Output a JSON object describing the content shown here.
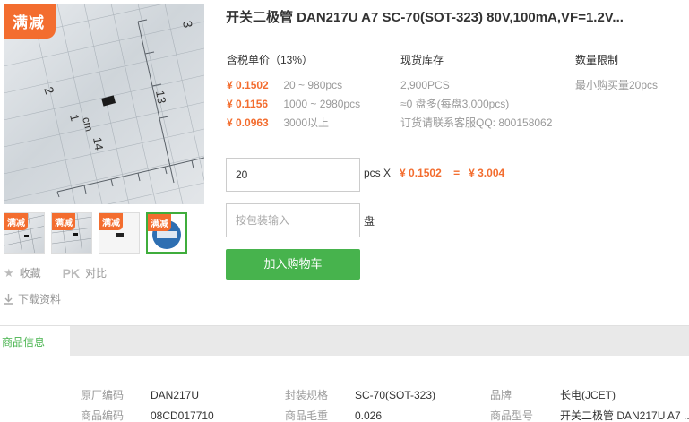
{
  "gallery": {
    "promo_tag": "满减",
    "thumb_tags": [
      "满减",
      "满减",
      "满减",
      "满减"
    ],
    "ruler_numbers": [
      "2",
      "3",
      "1",
      "cm",
      "14",
      "13"
    ]
  },
  "actions": {
    "favorite": "收藏",
    "pk": "PK",
    "compare": "对比",
    "download": "下载资料"
  },
  "product": {
    "title": "开关二极管 DAN217U A7  SC-70(SOT-323) 80V,100mA,VF=1.2V..."
  },
  "pricing": {
    "header": "含税单价（13%）",
    "tiers": [
      {
        "price": "¥ 0.1502",
        "range": "20 ~ 980pcs"
      },
      {
        "price": "¥ 0.1156",
        "range": "1000 ~ 2980pcs"
      },
      {
        "price": "¥ 0.0963",
        "range": "3000以上"
      }
    ]
  },
  "stock": {
    "header": "现货库存",
    "lines": [
      "2,900PCS",
      "≈0 盘多(每盘3,000pcs)",
      "订货请联系客服QQ: 800158062"
    ]
  },
  "limit": {
    "header": "数量限制",
    "lines": [
      "最小购买量20pcs"
    ]
  },
  "order": {
    "qty_value": "20",
    "qty_unit": "pcs X",
    "unit_price": "¥ 0.1502",
    "equals": "=",
    "total": "¥ 3.004",
    "reel_placeholder": "按包装输入",
    "reel_unit": "盘",
    "add_to_cart": "加入购物车"
  },
  "tabs": {
    "active": "商品信息"
  },
  "specs": [
    {
      "key": "原厂编码",
      "value": "DAN217U"
    },
    {
      "key": "封装规格",
      "value": "SC-70(SOT-323)"
    },
    {
      "key": "品牌",
      "value": "长电(JCET)"
    },
    {
      "key": "商品编码",
      "value": "08CD017710"
    },
    {
      "key": "商品毛重",
      "value": "0.026"
    },
    {
      "key": "商品型号",
      "value": "开关二极管 DAN217U A7 ..."
    }
  ],
  "colors": {
    "accent_orange": "#f36d2f",
    "accent_green": "#47b34d"
  }
}
